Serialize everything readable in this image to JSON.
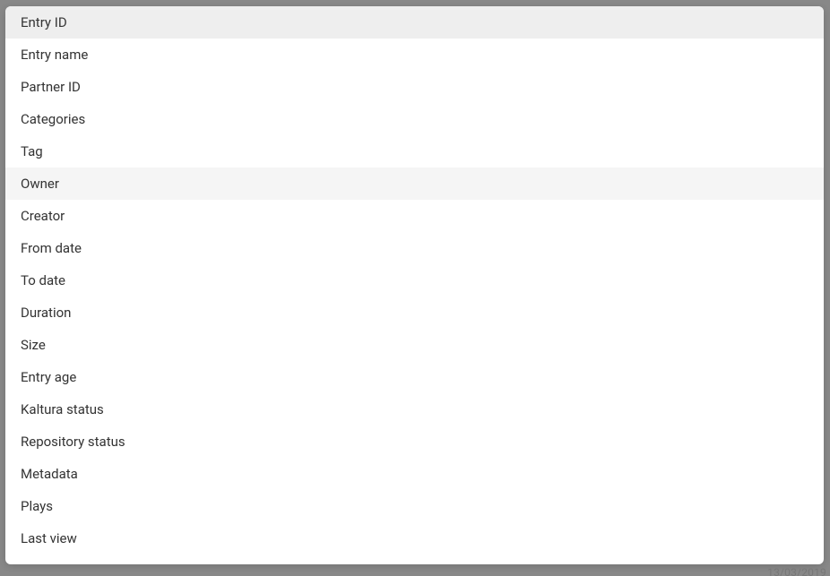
{
  "dropdown": {
    "options": [
      {
        "label": "Entry ID",
        "selected": true,
        "highlighted": false
      },
      {
        "label": "Entry name",
        "selected": false,
        "highlighted": false
      },
      {
        "label": "Partner ID",
        "selected": false,
        "highlighted": false
      },
      {
        "label": "Categories",
        "selected": false,
        "highlighted": false
      },
      {
        "label": "Tag",
        "selected": false,
        "highlighted": false
      },
      {
        "label": "Owner",
        "selected": false,
        "highlighted": true
      },
      {
        "label": "Creator",
        "selected": false,
        "highlighted": false
      },
      {
        "label": "From date",
        "selected": false,
        "highlighted": false
      },
      {
        "label": "To date",
        "selected": false,
        "highlighted": false
      },
      {
        "label": "Duration",
        "selected": false,
        "highlighted": false
      },
      {
        "label": "Size",
        "selected": false,
        "highlighted": false
      },
      {
        "label": "Entry age",
        "selected": false,
        "highlighted": false
      },
      {
        "label": "Kaltura status",
        "selected": false,
        "highlighted": false
      },
      {
        "label": "Repository status",
        "selected": false,
        "highlighted": false
      },
      {
        "label": "Metadata",
        "selected": false,
        "highlighted": false
      },
      {
        "label": "Plays",
        "selected": false,
        "highlighted": false
      },
      {
        "label": "Last view",
        "selected": false,
        "highlighted": false
      }
    ]
  },
  "footer": {
    "date_fragment": "13/03/2019"
  }
}
